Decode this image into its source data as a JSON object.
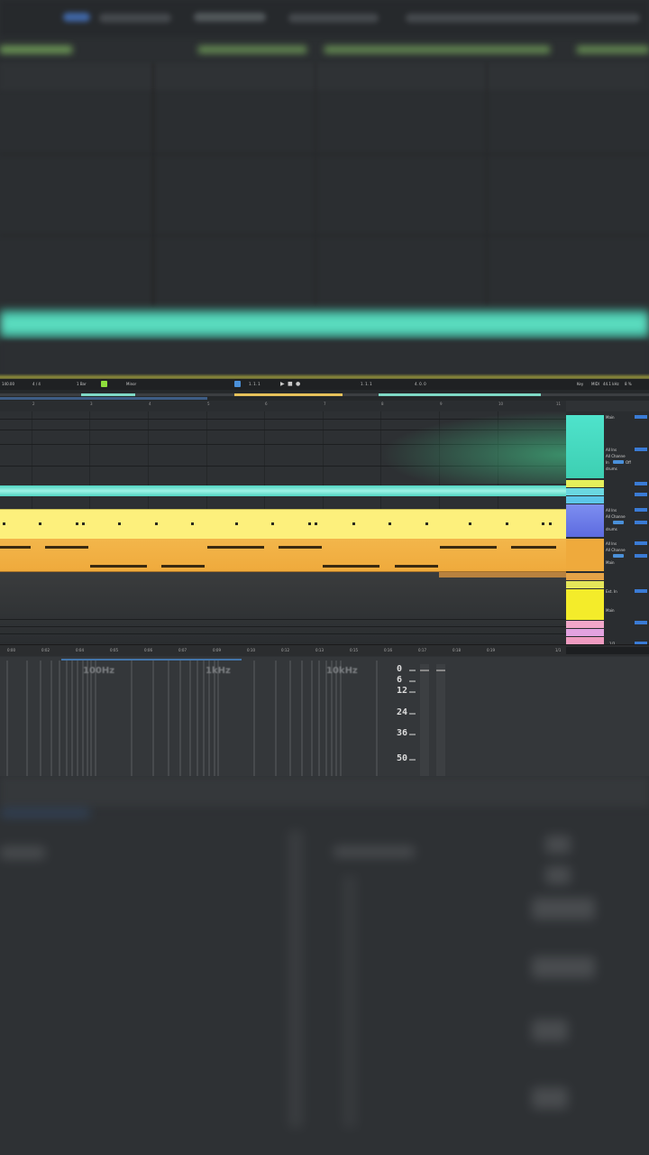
{
  "transport": {
    "tempo": "140.00",
    "signature": "4 / 4",
    "quantize": "1 Bar",
    "key": "Minor",
    "position": "1. 1. 1",
    "loop_start": "1. 1. 1",
    "loop_length": "4. 0. 0",
    "sample_rate": "44.1 kHz",
    "cpu": "8 %",
    "key_label": "Key",
    "midi_label": "MIDI"
  },
  "ruler": {
    "numbers": [
      "2",
      "3",
      "4",
      "5",
      "6",
      "7",
      "8",
      "9",
      "10",
      "11",
      "12"
    ]
  },
  "timebar": {
    "labels": [
      "0:00",
      "0:02",
      "0:04",
      "0:05",
      "0:06",
      "0:07",
      "0:09",
      "0:10",
      "0:12",
      "0:13",
      "0:15",
      "0:16",
      "0:17",
      "0:18",
      "0:19"
    ],
    "bar_ratio": "1/1"
  },
  "tracks": {
    "io_main": "Main",
    "io_all_ins": "All Ins",
    "io_all_channels": "All Channe",
    "io_in": "In",
    "io_off": "Off",
    "io_drums": "drums",
    "io_ext_in": "Ext. In",
    "io_ratio": "1/2",
    "colors": {
      "cyan": "#4fd2c0",
      "light_yellow": "#fdf07c",
      "orange": "#efaa3c",
      "blue_purple": "#6f7de8",
      "pink": "#f2a7c9",
      "yellow": "#f4ec2a"
    }
  },
  "eq": {
    "freq_labels": [
      "100Hz",
      "1kHz",
      "10kHz"
    ],
    "db_labels": [
      "0",
      "6",
      "12",
      "24",
      "36",
      "50"
    ]
  }
}
